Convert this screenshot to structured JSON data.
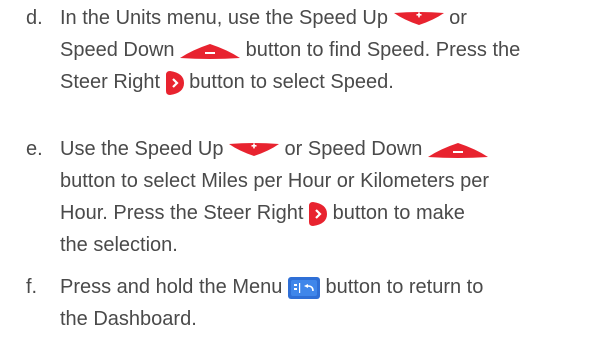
{
  "steps": [
    {
      "marker": "d.",
      "lines": [
        [
          "In the Units menu, use the Speed Up ",
          {
            "icon": "speed-up-icon"
          },
          " or"
        ],
        [
          "Speed Down ",
          {
            "icon": "speed-down-icon"
          },
          " button to find Speed. Press the"
        ],
        [
          "Steer Right ",
          {
            "icon": "steer-right-icon"
          },
          " button to select Speed."
        ]
      ]
    },
    {
      "marker": "e.",
      "lines": [
        [
          "Use the Speed Up ",
          {
            "icon": "speed-up-icon"
          },
          " or Speed Down ",
          {
            "icon": "speed-down-icon"
          }
        ],
        [
          "button to select Miles per Hour or Kilometers per"
        ],
        [
          "Hour. Press the Steer Right ",
          {
            "icon": "steer-right-icon"
          },
          " button to make"
        ],
        [
          "the selection."
        ]
      ]
    },
    {
      "marker": "f.",
      "lines": [
        [
          "Press and hold the Menu ",
          {
            "icon": "menu-icon"
          },
          " button to return to"
        ],
        [
          "the Dashboard."
        ]
      ]
    }
  ],
  "colors": {
    "text": "#4a4a4a",
    "button_red": "#e8232f",
    "menu_blue": "#2f6fd6"
  }
}
